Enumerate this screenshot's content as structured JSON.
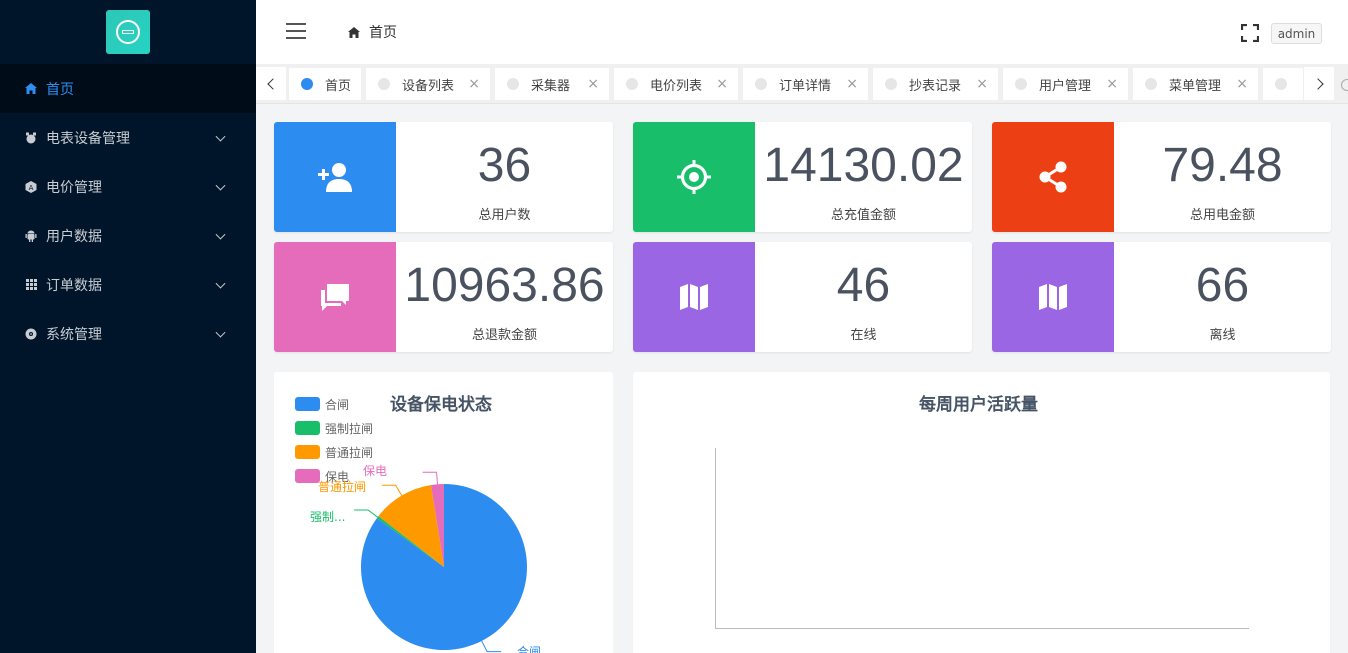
{
  "sidebar": {
    "items": [
      {
        "label": "首页",
        "icon": "home-icon",
        "active": true
      },
      {
        "label": "电表设备管理",
        "icon": "meter-icon"
      },
      {
        "label": "电价管理",
        "icon": "price-icon"
      },
      {
        "label": "用户数据",
        "icon": "android-icon"
      },
      {
        "label": "订单数据",
        "icon": "grid-icon"
      },
      {
        "label": "系统管理",
        "icon": "settings-icon"
      }
    ]
  },
  "header": {
    "breadcrumb": "首页",
    "user": "admin"
  },
  "tabs": [
    {
      "label": "首页",
      "active": true
    },
    {
      "label": "设备列表"
    },
    {
      "label": "采集器"
    },
    {
      "label": "电价列表"
    },
    {
      "label": "订单详情"
    },
    {
      "label": "抄表记录"
    },
    {
      "label": "用户管理"
    },
    {
      "label": "菜单管理"
    }
  ],
  "stats": [
    {
      "value": "36",
      "label": "总用户数",
      "color": "#2d8cf0",
      "icon": "user-add-icon"
    },
    {
      "value": "14130.02",
      "label": "总充值金额",
      "color": "#19be6b",
      "icon": "target-icon"
    },
    {
      "value": "79.48",
      "label": "总用电金额",
      "color": "#ed3f14",
      "icon": "share-icon"
    },
    {
      "value": "10963.86",
      "label": "总退款金额",
      "color": "#e46cbb",
      "icon": "chat-icon"
    },
    {
      "value": "46",
      "label": "在线",
      "color": "#9a66e4",
      "icon": "map-icon"
    },
    {
      "value": "66",
      "label": "离线",
      "color": "#9a66e4",
      "icon": "map-icon"
    }
  ],
  "pie_panel": {
    "title": "设备保电状态",
    "labels": {
      "hz": "合闸",
      "qz": "强制...",
      "pt": "普通拉闸",
      "bd": "保电"
    }
  },
  "line_panel": {
    "title": "每周用户活跃量"
  },
  "chart_data": [
    {
      "type": "pie",
      "title": "设备保电状态",
      "categories": [
        "合闸",
        "强制拉闸",
        "普通拉闸",
        "保电"
      ],
      "values": [
        85,
        0.5,
        12,
        2.5
      ],
      "colors": [
        "#2d8cf0",
        "#19be6b",
        "#ff9900",
        "#e46cbb"
      ],
      "legend": "top-left"
    },
    {
      "type": "line",
      "title": "每周用户活跃量",
      "series": []
    }
  ]
}
